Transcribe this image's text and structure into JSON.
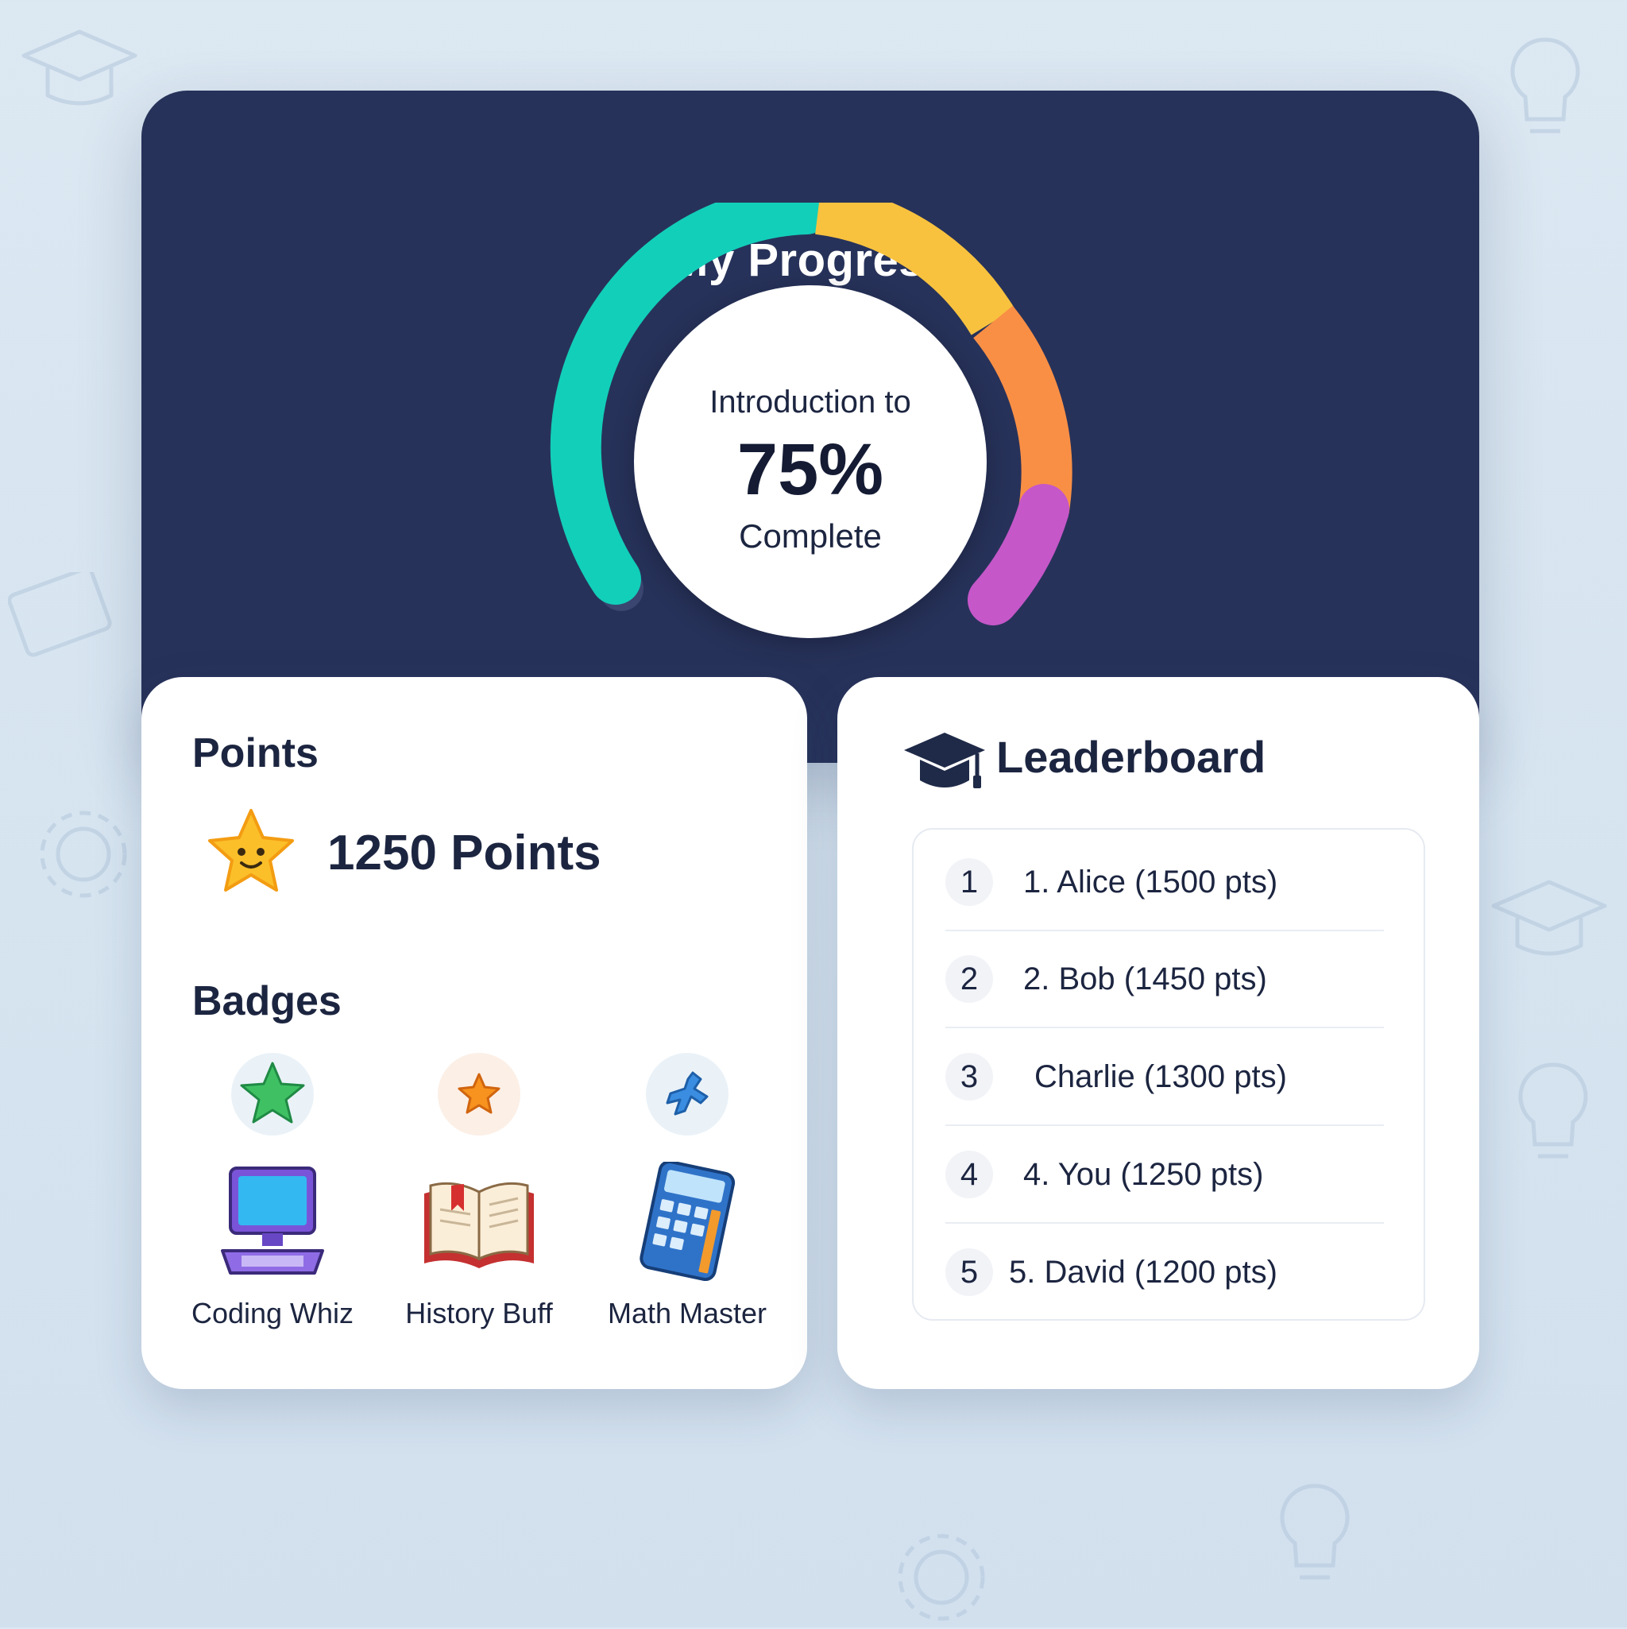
{
  "progress": {
    "title": "My Progress",
    "course_prefix": "Introduction to",
    "percent_text": "75%",
    "complete_label": "Complete",
    "percent_value": 75,
    "segment_colors": [
      "#12cfb9",
      "#f8c23f",
      "#f98f45",
      "#c557c9"
    ]
  },
  "points": {
    "heading": "Points",
    "icon": "star-icon",
    "value_text": "1250 Points"
  },
  "badges": {
    "heading": "Badges",
    "items": [
      {
        "label": "Coding Whiz",
        "icon": "computer-icon",
        "top_icon": "green-star-icon"
      },
      {
        "label": "History Buff",
        "icon": "open-book-icon",
        "top_icon": "orange-star-icon"
      },
      {
        "label": "Math Master",
        "icon": "calculator-icon",
        "top_icon": "blue-figure-icon"
      }
    ]
  },
  "leaderboard": {
    "heading": "Leaderboard",
    "icon": "graduation-cap-icon",
    "rows": [
      {
        "rank": "1",
        "name": "1. Alice (1500 pts)"
      },
      {
        "rank": "2",
        "name": "2. Bob (1450 pts)"
      },
      {
        "rank": "3",
        "name": "Charlie (1300 pts)"
      },
      {
        "rank": "4",
        "name": "4. You (1250 pts)"
      },
      {
        "rank": "5",
        "name": "5. David (1200 pts)"
      }
    ]
  }
}
